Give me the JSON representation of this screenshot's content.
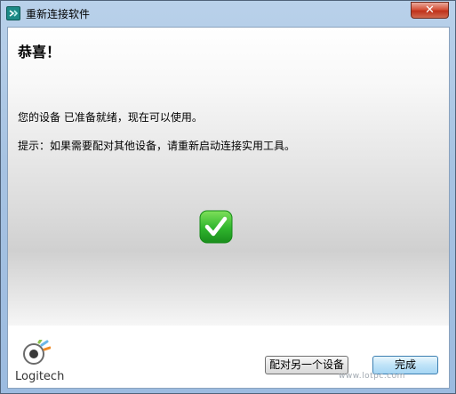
{
  "window": {
    "title": "重新连接软件",
    "close_label": "✕"
  },
  "content": {
    "heading": "恭喜！",
    "message_ready": "您的设备  已准备就绪，现在可以使用。",
    "message_hint": "提示：如果需要配对其他设备，请重新启动连接实用工具。",
    "status_icon": "checkmark-icon"
  },
  "footer": {
    "logo_text": "Logitech",
    "logo_icon": "logitech-logo-icon",
    "pair_another_label": "配对另一个设备",
    "done_label": "完成",
    "watermark": "www.lotpc.com"
  },
  "colors": {
    "check_green": "#2fb52d",
    "done_button_border": "#3c7fb1"
  }
}
